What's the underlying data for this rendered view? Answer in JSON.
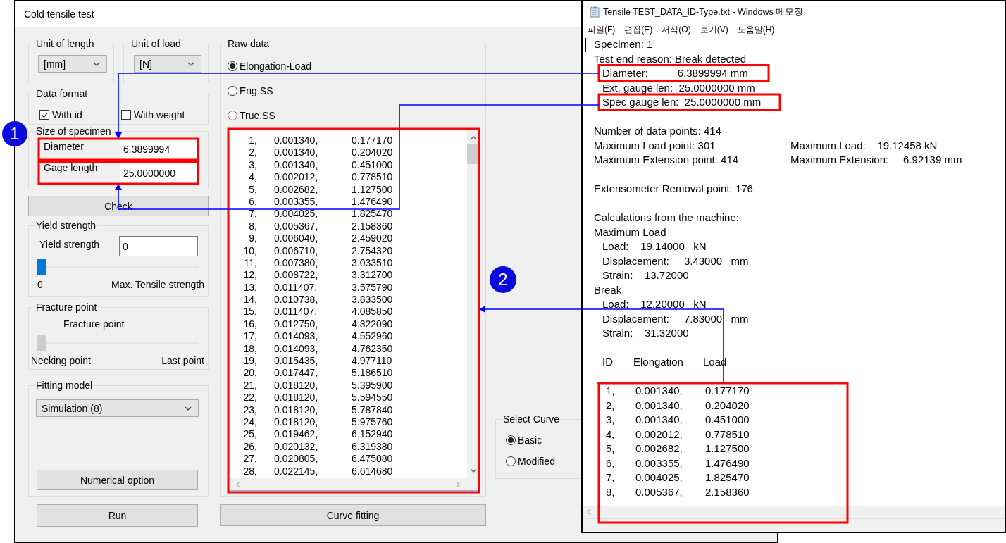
{
  "app_window": {
    "title": "Cold tensile test",
    "unit_of_length": {
      "label": "Unit of length",
      "value": "[mm]"
    },
    "unit_of_load": {
      "label": "Unit of load",
      "value": "[N]"
    },
    "data_format": {
      "label": "Data format",
      "options": [
        {
          "label": "With id",
          "checked": true
        },
        {
          "label": "With weight",
          "checked": false
        }
      ]
    },
    "size_of_specimen": {
      "label": "Size of specimen",
      "fields": [
        {
          "label": "Diameter",
          "value": "6.3899994"
        },
        {
          "label": "Gage length",
          "value": "25.0000000"
        }
      ]
    },
    "check_button": "Check",
    "yield_strength": {
      "label": "Yield strength",
      "field_label": "Yield strength",
      "value": "0",
      "level": 0,
      "disabled": false,
      "min_label": "0",
      "max_label": "Max. Tensile strength"
    },
    "fracture_point": {
      "label": "Fracture point",
      "slider_label": "Fracture point",
      "level": 0,
      "disabled": true,
      "min_label": "Necking point",
      "max_label": "Last point"
    },
    "fitting_model": {
      "label": "Fitting model",
      "value": "Simulation (8)",
      "button": "Numerical option"
    },
    "run_button": "Run",
    "raw_data": {
      "label": "Raw data",
      "options": [
        {
          "label": "Elongation-Load",
          "selected": true
        },
        {
          "label": "Eng.SS",
          "selected": false
        },
        {
          "label": "True.SS",
          "selected": false
        }
      ],
      "rows": [
        [
          "1,",
          "0.001340,",
          "0.177170"
        ],
        [
          "2,",
          "0.001340,",
          "0.204020"
        ],
        [
          "3,",
          "0.001340,",
          "0.451000"
        ],
        [
          "4,",
          "0.002012,",
          "0.778510"
        ],
        [
          "5,",
          "0.002682,",
          "1.127500"
        ],
        [
          "6,",
          "0.003355,",
          "1.476490"
        ],
        [
          "7,",
          "0.004025,",
          "1.825470"
        ],
        [
          "8,",
          "0.005367,",
          "2.158360"
        ],
        [
          "9,",
          "0.006040,",
          "2.459020"
        ],
        [
          "10,",
          "0.006710,",
          "2.754320"
        ],
        [
          "11,",
          "0.007380,",
          "3.033510"
        ],
        [
          "12,",
          "0.008722,",
          "3.312700"
        ],
        [
          "13,",
          "0.011407,",
          "3.575790"
        ],
        [
          "14,",
          "0.010738,",
          "3.833500"
        ],
        [
          "15,",
          "0.011407,",
          "4.085850"
        ],
        [
          "16,",
          "0.012750,",
          "4.322090"
        ],
        [
          "17,",
          "0.014093,",
          "4.552960"
        ],
        [
          "18,",
          "0.014093,",
          "4.762350"
        ],
        [
          "19,",
          "0.015435,",
          "4.977110"
        ],
        [
          "20,",
          "0.017447,",
          "5.186510"
        ],
        [
          "21,",
          "0.018120,",
          "5.395900"
        ],
        [
          "22,",
          "0.018120,",
          "5.594550"
        ],
        [
          "23,",
          "0.018120,",
          "5.787840"
        ],
        [
          "24,",
          "0.018120,",
          "5.975760"
        ],
        [
          "25,",
          "0.019462,",
          "6.152940"
        ],
        [
          "26,",
          "0.020132,",
          "6.319380"
        ],
        [
          "27,",
          "0.020805,",
          "6.475080"
        ],
        [
          "28,",
          "0.022145,",
          "6.614680"
        ]
      ]
    },
    "curve_fitting_button": "Curve fitting",
    "select_curve": {
      "label": "Select Curve",
      "options": [
        {
          "label": "Basic",
          "selected": true
        },
        {
          "label": "Modified",
          "selected": false
        }
      ]
    }
  },
  "notepad": {
    "title": "Tensile TEST_DATA_ID-Type.txt - Windows 메모장",
    "menu": [
      "파일(F)",
      "편집(E)",
      "서식(O)",
      "보기(V)",
      "도움말(H)"
    ],
    "sections": [
      [
        {
          "text": "Specimen: 1"
        },
        {
          "text": "Test end reason: Break detected",
          "children": [
            {
              "text": "Diameter:          6.3899994 mm"
            },
            {
              "text": "Ext. gauge len:  25.0000000 mm"
            },
            {
              "text": "Spec gauge len:  25.0000000 mm"
            }
          ]
        }
      ],
      [
        {
          "text": "Number of data points: 414"
        },
        {
          "text": "Maximum Load point: 301",
          "aside": "Maximum Load:    19.12458 kN"
        },
        {
          "text": "Maximum Extension point: 414",
          "aside": "Maximum Extension:     6.92139 mm"
        }
      ],
      [
        {
          "text": "Extensometer Removal point: 176"
        }
      ],
      [
        {
          "text": "Calculations from the machine:"
        },
        {
          "text": "Maximum Load",
          "children": [
            {
              "text": "Load:    19.14000   kN"
            },
            {
              "text": "Displacement:     3.43000   mm"
            },
            {
              "text": "Strain:    13.72000"
            }
          ]
        },
        {
          "text": "Break",
          "children": [
            {
              "text": "Load:    12.20000   kN"
            },
            {
              "text": "Displacement:     7.83000   mm"
            },
            {
              "text": "Strain:    31.32000"
            }
          ]
        }
      ]
    ],
    "table": {
      "columns": [
        "ID",
        "Elongation",
        "Load"
      ],
      "rows": [
        [
          "1,",
          "0.001340,",
          "0.177170"
        ],
        [
          "2,",
          "0.001340,",
          "0.204020"
        ],
        [
          "3,",
          "0.001340,",
          "0.451000"
        ],
        [
          "4,",
          "0.002012,",
          "0.778510"
        ],
        [
          "5,",
          "0.002682,",
          "1.127500"
        ],
        [
          "6,",
          "0.003355,",
          "1.476490"
        ],
        [
          "7,",
          "0.004025,",
          "1.825470"
        ],
        [
          "8,",
          "0.005367,",
          "2.158360"
        ]
      ]
    }
  },
  "annotations": {
    "callouts": [
      "1",
      "2"
    ]
  }
}
